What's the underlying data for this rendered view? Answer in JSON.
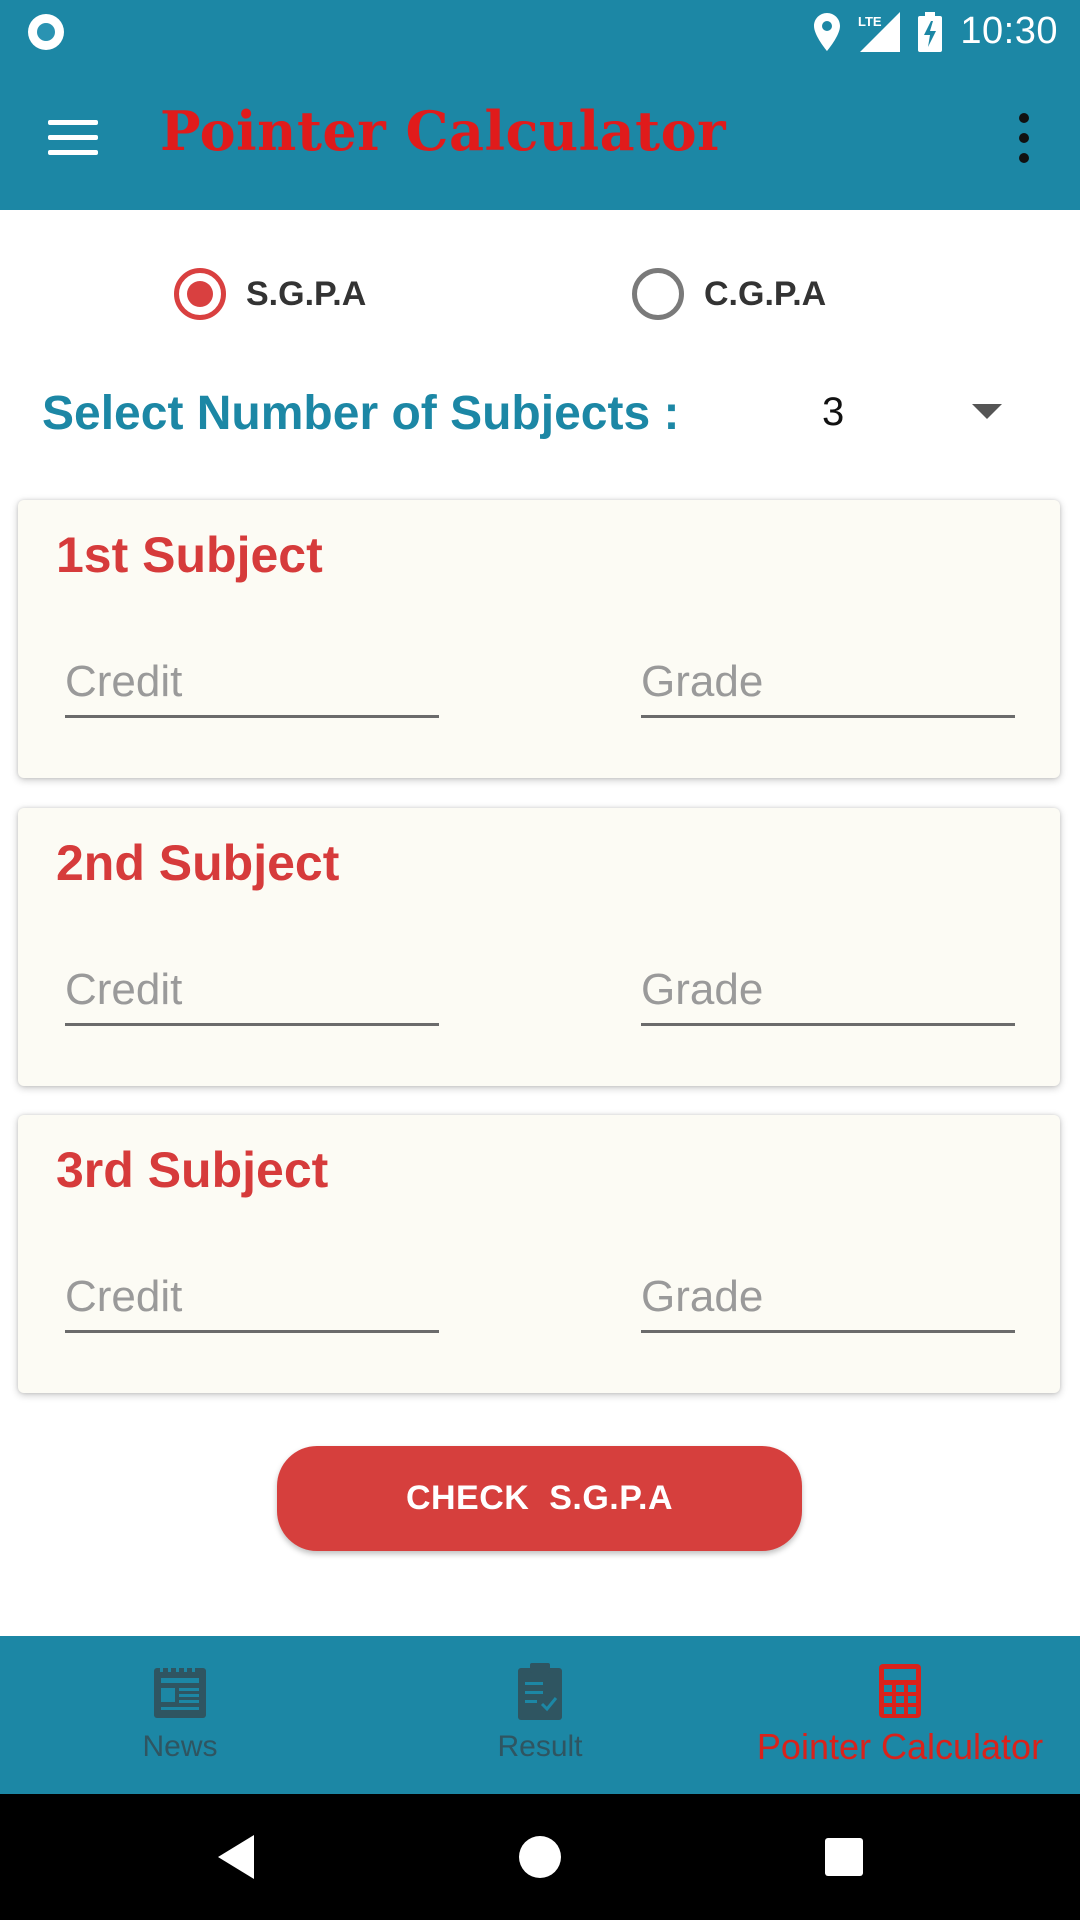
{
  "status_bar": {
    "time": "10:30",
    "network": "LTE"
  },
  "app_bar": {
    "title": "Pointer Calculator"
  },
  "mode": {
    "options": [
      {
        "label": "S.G.P.A",
        "selected": true
      },
      {
        "label": "C.G.P.A",
        "selected": false
      }
    ]
  },
  "subjects_selector": {
    "label": "Select Number of Subjects :",
    "value": "3"
  },
  "subjects": [
    {
      "title": "1st Subject",
      "credit_placeholder": "Credit",
      "grade_placeholder": "Grade"
    },
    {
      "title": "2nd Subject",
      "credit_placeholder": "Credit",
      "grade_placeholder": "Grade"
    },
    {
      "title": "3rd Subject",
      "credit_placeholder": "Credit",
      "grade_placeholder": "Grade"
    }
  ],
  "check_button": {
    "label": "CHECK  S.G.P.A"
  },
  "bottom_nav": {
    "items": [
      {
        "label": "News",
        "icon": "news-icon",
        "active": false
      },
      {
        "label": "Result",
        "icon": "clipboard-check-icon",
        "active": false
      },
      {
        "label": "Pointer Calculator",
        "icon": "calculator-icon",
        "active": true
      }
    ]
  },
  "colors": {
    "primary": "#1c87a5",
    "accent": "#d63f3d",
    "title_red": "#e01b1b",
    "card_background": "#fcfbf4"
  }
}
